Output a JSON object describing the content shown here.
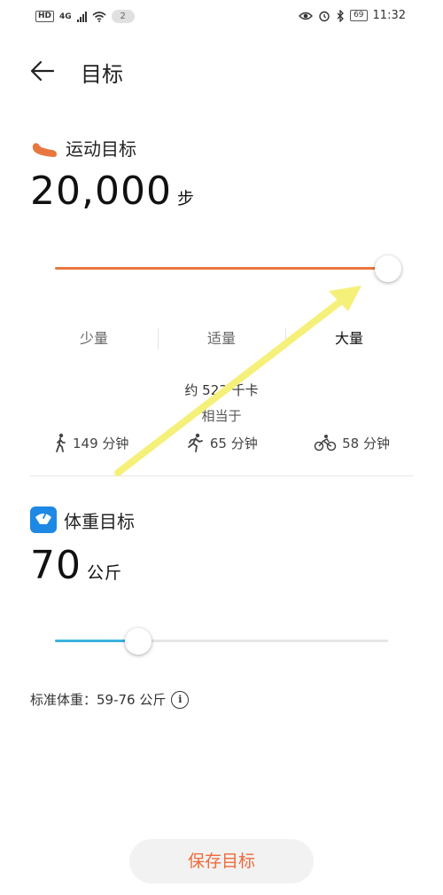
{
  "status_bar": {
    "left": {
      "hd": "HD",
      "network": "4G",
      "notification_count": "2"
    },
    "right": {
      "battery": "69",
      "time": "11:32"
    }
  },
  "header": {
    "title": "目标"
  },
  "exercise": {
    "title": "运动目标",
    "value": "20,000",
    "unit": "步",
    "slider_fraction": 1.0,
    "accent": "#e8773f",
    "levels": [
      "少量",
      "适量",
      "大量"
    ],
    "active_level": "大量",
    "kcal_text": "约 523 千卡",
    "equiv_text": "相当于",
    "activities": [
      {
        "icon": "walking-icon",
        "text": "149 分钟"
      },
      {
        "icon": "running-icon",
        "text": "65 分钟"
      },
      {
        "icon": "cycling-icon",
        "text": "58 分钟"
      }
    ]
  },
  "weight": {
    "title": "体重目标",
    "value": "70",
    "unit": "公斤",
    "slider_fraction": 0.25,
    "accent": "#3bb3e0",
    "standard_text": "标准体重：59-76 公斤"
  },
  "save_button": {
    "label": "保存目标"
  },
  "overlay": {
    "arrow_color": "#f5f07a"
  }
}
